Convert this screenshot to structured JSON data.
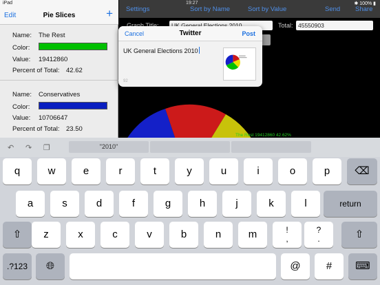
{
  "status_bar": {
    "device": "iPad",
    "time": "19:27",
    "battery": "100%"
  },
  "master": {
    "edit_label": "Edit",
    "title": "Pie Slices",
    "add_label": "+",
    "slices": [
      {
        "name_label": "Name:",
        "name": "The Rest",
        "color_label": "Color:",
        "color": "#00c000",
        "value_label": "Value:",
        "value": "19412860",
        "percent_label": "Percent of Total:",
        "percent": "42.62"
      },
      {
        "name_label": "Name:",
        "name": "Conservatives",
        "color_label": "Color:",
        "color": "#0a1fc0",
        "value_label": "Value:",
        "value": "10706647",
        "percent_label": "Percent of Total:",
        "percent": "23.50"
      }
    ]
  },
  "detail": {
    "settings_label": "Settings",
    "sort_name_label": "Sort by Name",
    "sort_value_label": "Sort by Value",
    "send_label": "Send",
    "share_label": "Share",
    "graph_title_label": "Graph Title:",
    "graph_title_value": "UK General Elections 2010",
    "total_label": "Total:",
    "total_value": "45550903",
    "chart_note": "The Rest 19412860 42.62%"
  },
  "twitter_sheet": {
    "cancel_label": "Cancel",
    "title": "Twitter",
    "post_label": "Post",
    "text": "UK General Elections 2010",
    "char_count": "92"
  },
  "keyboard": {
    "suggestion": "\"2010\"",
    "row1": [
      "q",
      "w",
      "e",
      "r",
      "t",
      "y",
      "u",
      "i",
      "o",
      "p"
    ],
    "row2": [
      "a",
      "s",
      "d",
      "f",
      "g",
      "h",
      "j",
      "k",
      "l"
    ],
    "row3": [
      "z",
      "x",
      "c",
      "v",
      "b",
      "n",
      "m"
    ],
    "return_label": "return",
    "numbers_label": ".?123",
    "at_label": "@",
    "hash_label": "#",
    "punct1_top": "!",
    "punct1_bottom": ",",
    "punct2_top": "?",
    "punct2_bottom": "."
  },
  "colors": {
    "pie_red": "#cc1a1a",
    "pie_yellow": "#c8c20a",
    "pie_blue": "#1420c8",
    "pie_green": "#00c000"
  }
}
